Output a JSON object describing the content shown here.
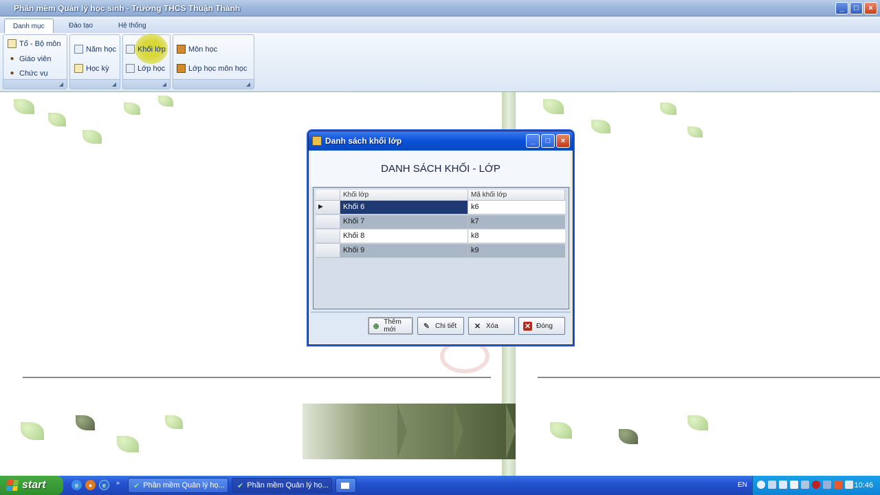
{
  "window": {
    "title": "Phần mềm Quản lý học sinh - Trường THCS Thuận Thành",
    "buttons": {
      "minimize": "_",
      "maximize": "□",
      "close": "×"
    }
  },
  "ribbon": {
    "tabs": [
      "Danh mục",
      "Đào tạo",
      "Hệ thống"
    ],
    "active_tab": "Danh mục",
    "groups": [
      {
        "items": [
          "Tổ - Bộ môn",
          "Giáo viên",
          "Chức vụ"
        ]
      },
      {
        "items": [
          "Năm học",
          "Học kỳ"
        ]
      },
      {
        "items": [
          "Khối lớp",
          "Lớp học"
        ]
      },
      {
        "items": [
          "Môn học",
          "Lớp học môn học"
        ]
      }
    ]
  },
  "dialog": {
    "title": "Danh sách khối lớp",
    "heading": "DANH SÁCH KHỐI - LỚP",
    "columns": [
      "Khối lớp",
      "Mã khối lớp"
    ],
    "rows": [
      {
        "khoi": "Khối 6",
        "ma": "k6"
      },
      {
        "khoi": "Khối 7",
        "ma": "k7"
      },
      {
        "khoi": "Khối 8",
        "ma": "k8"
      },
      {
        "khoi": "Khối 9",
        "ma": "k9"
      }
    ],
    "selected_row_marker": "▶",
    "buttons": {
      "add": "Thêm mới",
      "detail": "Chi tiết",
      "delete": "Xóa",
      "close": "Đóng"
    }
  },
  "taskbar": {
    "start_label": "start",
    "tasks": [
      "Phần mềm Quản lý họ...",
      "Phần mềm Quản lý họ..."
    ],
    "language": "EN",
    "clock": "10:46"
  },
  "colors": {
    "selection": "#1f3a73",
    "alt_row": "#a9b6c6",
    "dialog_titlebar": "#0a50d8",
    "taskbar": "#2452cf"
  }
}
